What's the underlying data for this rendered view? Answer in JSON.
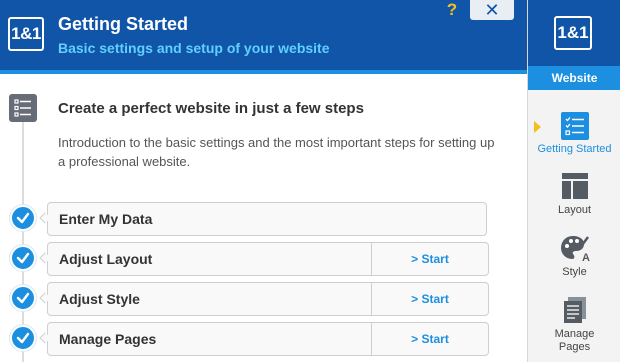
{
  "header": {
    "logo": "1&1",
    "title": "Getting Started",
    "subtitle": "Basic settings and setup of your website",
    "help": "?",
    "close": "✕"
  },
  "intro": {
    "title": "Create a perfect website in just a few steps",
    "text": "Introduction to the basic settings and the most important steps for setting up a professional website."
  },
  "steps": [
    {
      "label": "Enter My Data",
      "action": ""
    },
    {
      "label": "Adjust Layout",
      "action": "> Start"
    },
    {
      "label": "Adjust Style",
      "action": "> Start"
    },
    {
      "label": "Manage Pages",
      "action": "> Start"
    }
  ],
  "sidebar": {
    "logo": "1&1",
    "section": "Website",
    "items": [
      {
        "label": "Getting Started",
        "icon": "checklist-icon",
        "active": true
      },
      {
        "label": "Layout",
        "icon": "layout-icon",
        "active": false
      },
      {
        "label": "Style",
        "icon": "palette-icon",
        "active": false
      },
      {
        "label": "Manage Pages",
        "icon": "pages-icon",
        "active": false
      }
    ]
  },
  "colors": {
    "brand_blue": "#1155a8",
    "accent_blue": "#1c8fe0",
    "accent_yellow": "#f2c01c"
  }
}
